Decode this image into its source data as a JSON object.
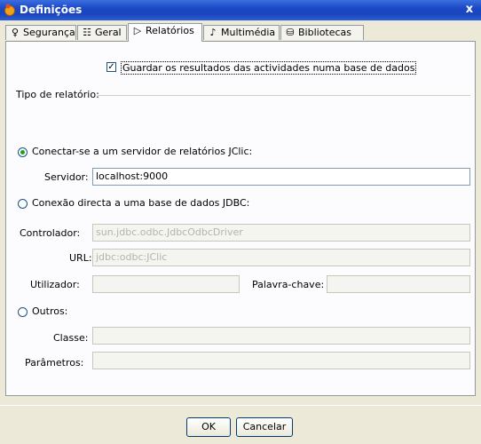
{
  "window": {
    "title": "Definições",
    "close_glyph": "x"
  },
  "tabs": [
    {
      "label": "Segurança",
      "icon": "lightbulb-icon",
      "glyph": "♀"
    },
    {
      "label": "Geral",
      "icon": "list-icon",
      "glyph": "☷"
    },
    {
      "label": "Relatórios",
      "icon": "report-icon",
      "glyph": "▷"
    },
    {
      "label": "Multimédia",
      "icon": "speaker-icon",
      "glyph": "♪"
    },
    {
      "label": "Bibliotecas",
      "icon": "database-icon",
      "glyph": "⛁"
    }
  ],
  "active_tab": "Relatórios",
  "save_checkbox": {
    "label": "Guardar os resultados das actividades numa base de dados",
    "checked": true,
    "check_glyph": "✓"
  },
  "report_type": {
    "title": "Tipo de relatório:",
    "server_option": {
      "label": "Conectar-se a um servidor de relatórios JClic:",
      "selected": true
    },
    "server_label": "Servidor:",
    "server_value": "localhost:9000",
    "jdbc_option": {
      "label": "Conexão directa a uma base de dados JDBC:",
      "selected": false
    },
    "driver_label": "Controlador:",
    "driver_value": "sun.jdbc.odbc.JdbcOdbcDriver",
    "url_label": "URL:",
    "url_value": "jdbc:odbc:JClic",
    "user_label": "Utilizador:",
    "user_value": "",
    "password_label": "Palavra-chave:",
    "password_value": "",
    "other_option": {
      "label": "Outros:",
      "selected": false
    },
    "class_label": "Classe:",
    "class_value": "",
    "params_label": "Parâmetros:",
    "params_value": ""
  },
  "buttons": {
    "ok": "OK",
    "cancel": "Cancelar"
  },
  "colors": {
    "titlebar": "#1c48c4",
    "radio_dot": "#21a121"
  }
}
